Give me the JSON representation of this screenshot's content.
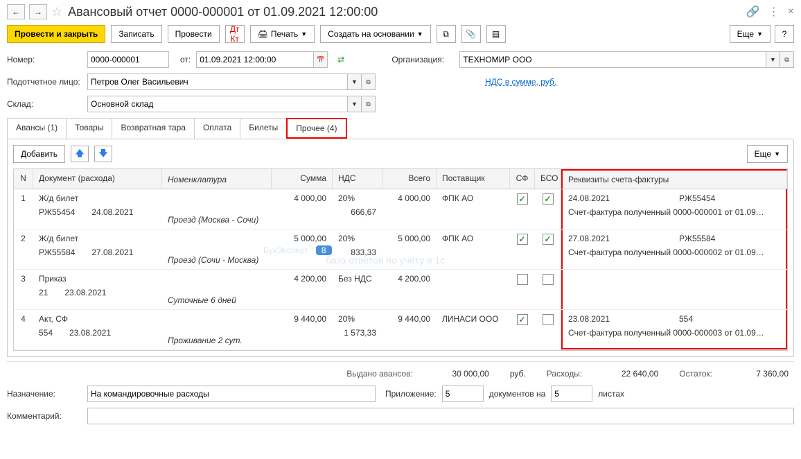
{
  "title": "Авансовый отчет 0000-000001 от 01.09.2021 12:00:00",
  "toolbar": {
    "post_close": "Провести и закрыть",
    "write": "Записать",
    "post": "Провести",
    "print": "Печать",
    "create_based": "Создать на основании",
    "more": "Еще"
  },
  "fields": {
    "number_label": "Номер:",
    "number": "0000-000001",
    "from_label": "от:",
    "date": "01.09.2021 12:00:00",
    "org_label": "Организация:",
    "org": "ТЕХНОМИР ООО",
    "person_label": "Подотчетное лицо:",
    "person": "Петров Олег Васильевич",
    "vat_link": "НДС в сумме, руб.",
    "warehouse_label": "Склад:",
    "warehouse": "Основной склад"
  },
  "tabs": {
    "advances": "Авансы (1)",
    "goods": "Товары",
    "returnable": "Возвратная тара",
    "payment": "Оплата",
    "tickets": "Билеты",
    "other": "Прочее (4)"
  },
  "sub": {
    "add": "Добавить",
    "more": "Еще"
  },
  "headers": {
    "n": "N",
    "doc": "Документ (расхода)",
    "nom": "Номенклатура",
    "sum": "Сумма",
    "nds": "НДС",
    "total": "Всего",
    "supplier": "Поставщик",
    "sf": "СФ",
    "bso": "БСО",
    "rek": "Реквизиты счета-фактуры"
  },
  "rows": [
    {
      "n": "1",
      "doc": "Ж/д билет",
      "doc_num": "РЖ55454",
      "doc_date": "24.08.2021",
      "nom": "Проезд (Москва - Сочи)",
      "sum": "4 000,00",
      "nds": "20%",
      "nds_val": "666,67",
      "total": "4 000,00",
      "supplier": "ФПК АО",
      "sf": true,
      "bso": true,
      "rek_date": "24.08.2021",
      "rek_num": "РЖ55454",
      "rek_doc": "Счет-фактура полученный 0000-000001 от 01.09…"
    },
    {
      "n": "2",
      "doc": "Ж/д билет",
      "doc_num": "РЖ55584",
      "doc_date": "27.08.2021",
      "nom": "Проезд (Сочи - Москва)",
      "sum": "5 000,00",
      "nds": "20%",
      "nds_val": "833,33",
      "total": "5 000,00",
      "supplier": "ФПК АО",
      "sf": true,
      "bso": true,
      "rek_date": "27.08.2021",
      "rek_num": "РЖ55584",
      "rek_doc": "Счет-фактура полученный 0000-000002 от 01.09…"
    },
    {
      "n": "3",
      "doc": "Приказ",
      "doc_num": "21",
      "doc_date": "23.08.2021",
      "nom": "Суточные 6 дней",
      "sum": "4 200,00",
      "nds": "Без НДС",
      "nds_val": "",
      "total": "4 200,00",
      "supplier": "",
      "sf": false,
      "bso": false,
      "rek_date": "",
      "rek_num": "",
      "rek_doc": ""
    },
    {
      "n": "4",
      "doc": "Акт, СФ",
      "doc_num": "554",
      "doc_date": "23.08.2021",
      "nom": "Проживание 2 сут.",
      "sum": "9 440,00",
      "nds": "20%",
      "nds_val": "1 573,33",
      "total": "9 440,00",
      "supplier": "ЛИНАСИ ООО",
      "sf": true,
      "bso": false,
      "rek_date": "23.08.2021",
      "rek_num": "554",
      "rek_doc": "Счет-фактура полученный 0000-000003 от 01.09…"
    }
  ],
  "totals": {
    "advances_label": "Выдано авансов:",
    "advances": "30 000,00",
    "currency": "руб.",
    "expenses_label": "Расходы:",
    "expenses": "22 640,00",
    "balance_label": "Остаток:",
    "balance": "7 360,00"
  },
  "bottom": {
    "purpose_label": "Назначение:",
    "purpose": "На командировочные расходы",
    "attachment_label": "Приложение:",
    "attachment_count": "5",
    "docs_on": "документов на",
    "sheets_count": "5",
    "sheets": "листах",
    "comment_label": "Комментарий:"
  },
  "watermark": {
    "main": "БухЭксперт",
    "badge": "8",
    "sub": "база ответов по учёту в 1с"
  }
}
